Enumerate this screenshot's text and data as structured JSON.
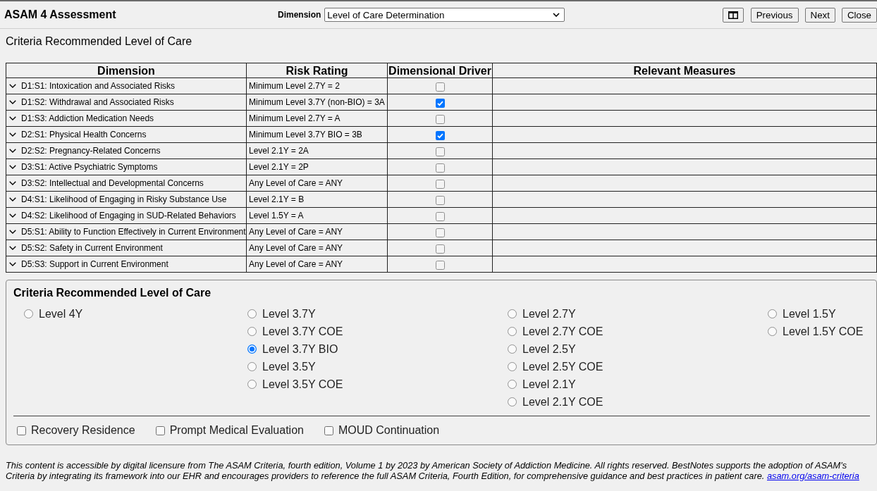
{
  "header": {
    "title": "ASAM 4 Assessment",
    "dimension_label": "Dimension",
    "dimension_value": "Level of Care Determination",
    "buttons": [
      "Previous",
      "Next",
      "Close"
    ]
  },
  "section_title": "Criteria Recommended Level of Care",
  "table": {
    "columns": [
      "Dimension",
      "Risk Rating",
      "Dimensional Driver",
      "Relevant Measures"
    ],
    "rows": [
      {
        "dimension": "D1:S1: Intoxication and Associated Risks",
        "risk_rating": "Minimum Level 2.7Y = 2",
        "driver": false
      },
      {
        "dimension": "D1:S2: Withdrawal and Associated Risks",
        "risk_rating": "Minimum Level 3.7Y (non-BIO) = 3A",
        "driver": true
      },
      {
        "dimension": "D1:S3: Addiction Medication Needs",
        "risk_rating": "Minimum Level 2.7Y = A",
        "driver": false
      },
      {
        "dimension": "D2:S1: Physical Health Concerns",
        "risk_rating": "Minimum Level 3.7Y BIO = 3B",
        "driver": true
      },
      {
        "dimension": "D2:S2: Pregnancy-Related Concerns",
        "risk_rating": "Level 2.1Y = 2A",
        "driver": false
      },
      {
        "dimension": "D3:S1: Active Psychiatric Symptoms",
        "risk_rating": "Level 2.1Y = 2P",
        "driver": false
      },
      {
        "dimension": "D3:S2: Intellectual and Developmental Concerns",
        "risk_rating": "Any Level of Care = ANY",
        "driver": false
      },
      {
        "dimension": "D4:S1: Likelihood of Engaging in Risky Substance Use",
        "risk_rating": "Level 2.1Y = B",
        "driver": false
      },
      {
        "dimension": "D4:S2: Likelihood of Engaging in SUD-Related Behaviors",
        "risk_rating": "Level 1.5Y = A",
        "driver": false
      },
      {
        "dimension": "D5:S1: Ability to Function Effectively in Current Environment",
        "risk_rating": "Any Level of Care = ANY",
        "driver": false
      },
      {
        "dimension": "D5:S2: Safety in Current Environment",
        "risk_rating": "Any Level of Care = ANY",
        "driver": false
      },
      {
        "dimension": "D5:S3: Support in Current Environment",
        "risk_rating": "Any Level of Care = ANY",
        "driver": false
      }
    ]
  },
  "level_of_care": {
    "title": "Criteria Recommended Level of Care",
    "option_columns": [
      [
        {
          "label": "Level 4Y",
          "selected": false
        }
      ],
      [
        {
          "label": "Level 3.7Y",
          "selected": false
        },
        {
          "label": "Level 3.7Y COE",
          "selected": false
        },
        {
          "label": "Level 3.7Y BIO",
          "selected": true
        },
        {
          "label": "Level 3.5Y",
          "selected": false
        },
        {
          "label": "Level 3.5Y COE",
          "selected": false
        }
      ],
      [
        {
          "label": "Level 2.7Y",
          "selected": false
        },
        {
          "label": "Level 2.7Y COE",
          "selected": false
        },
        {
          "label": "Level 2.5Y",
          "selected": false
        },
        {
          "label": "Level 2.5Y COE",
          "selected": false
        },
        {
          "label": "Level 2.1Y",
          "selected": false
        },
        {
          "label": "Level 2.1Y COE",
          "selected": false
        }
      ],
      [
        {
          "label": "Level 1.5Y",
          "selected": false
        },
        {
          "label": "Level 1.5Y COE",
          "selected": false
        }
      ]
    ],
    "flags": [
      {
        "label": "Recovery Residence",
        "checked": false
      },
      {
        "label": "Prompt Medical Evaluation",
        "checked": false
      },
      {
        "label": "MOUD Continuation",
        "checked": false
      }
    ]
  },
  "footer": {
    "text": "This content is accessible by digital licensure from The ASAM Criteria, fourth edition, Volume 1 by 2023 by American Society of Addiction Medicine. All rights reserved. BestNotes supports the adoption of ASAM's Criteria by integrating its framework into our EHR and encourages providers to reference the full ASAM Criteria, Fourth Edition, for comprehensive guidance and best practices in patient care.",
    "link": "asam.org/asam-criteria"
  }
}
